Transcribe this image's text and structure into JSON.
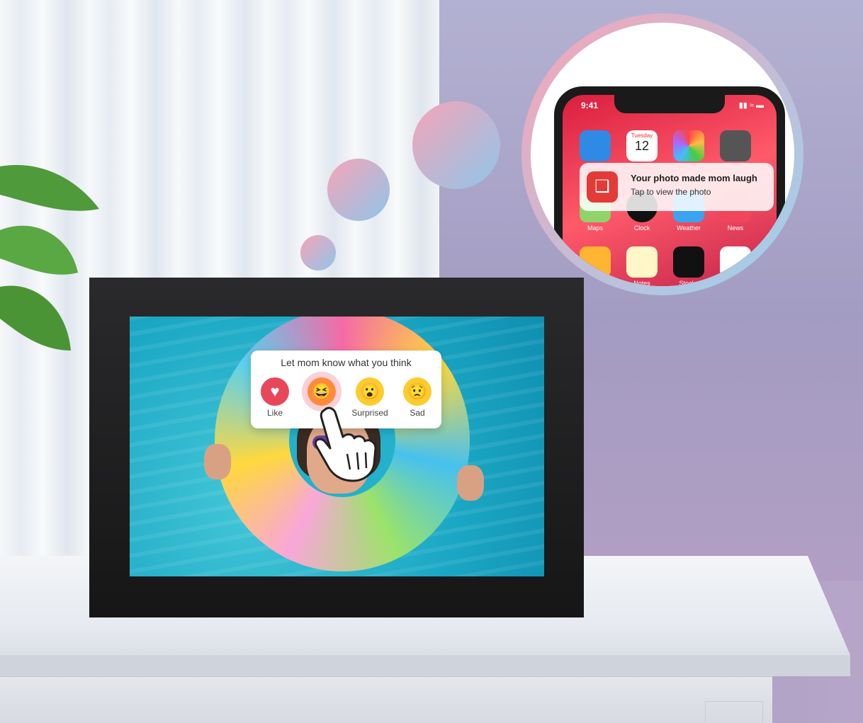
{
  "frame_reaction": {
    "prompt": "Let mom know what you think",
    "options": [
      {
        "label": "Like",
        "icon": "heart-icon",
        "color": "#e8475a"
      },
      {
        "label": "",
        "icon": "laugh-icon",
        "color": "#ff8a3d"
      },
      {
        "label": "Surprised",
        "icon": "surprised-icon",
        "color": "#ffcb2d"
      },
      {
        "label": "Sad",
        "icon": "sad-icon",
        "color": "#ffcb2d"
      }
    ]
  },
  "phone": {
    "status_time": "9:41",
    "calendar_day": "Tuesday",
    "calendar_date": "12",
    "apps_row2": [
      "Maps",
      "Clock",
      "Weather",
      "News"
    ],
    "apps_row3": [
      "",
      "Notes",
      "Stocks",
      ""
    ],
    "notification": {
      "title": "Your photo made mom laugh",
      "body": "Tap to view the photo"
    }
  }
}
